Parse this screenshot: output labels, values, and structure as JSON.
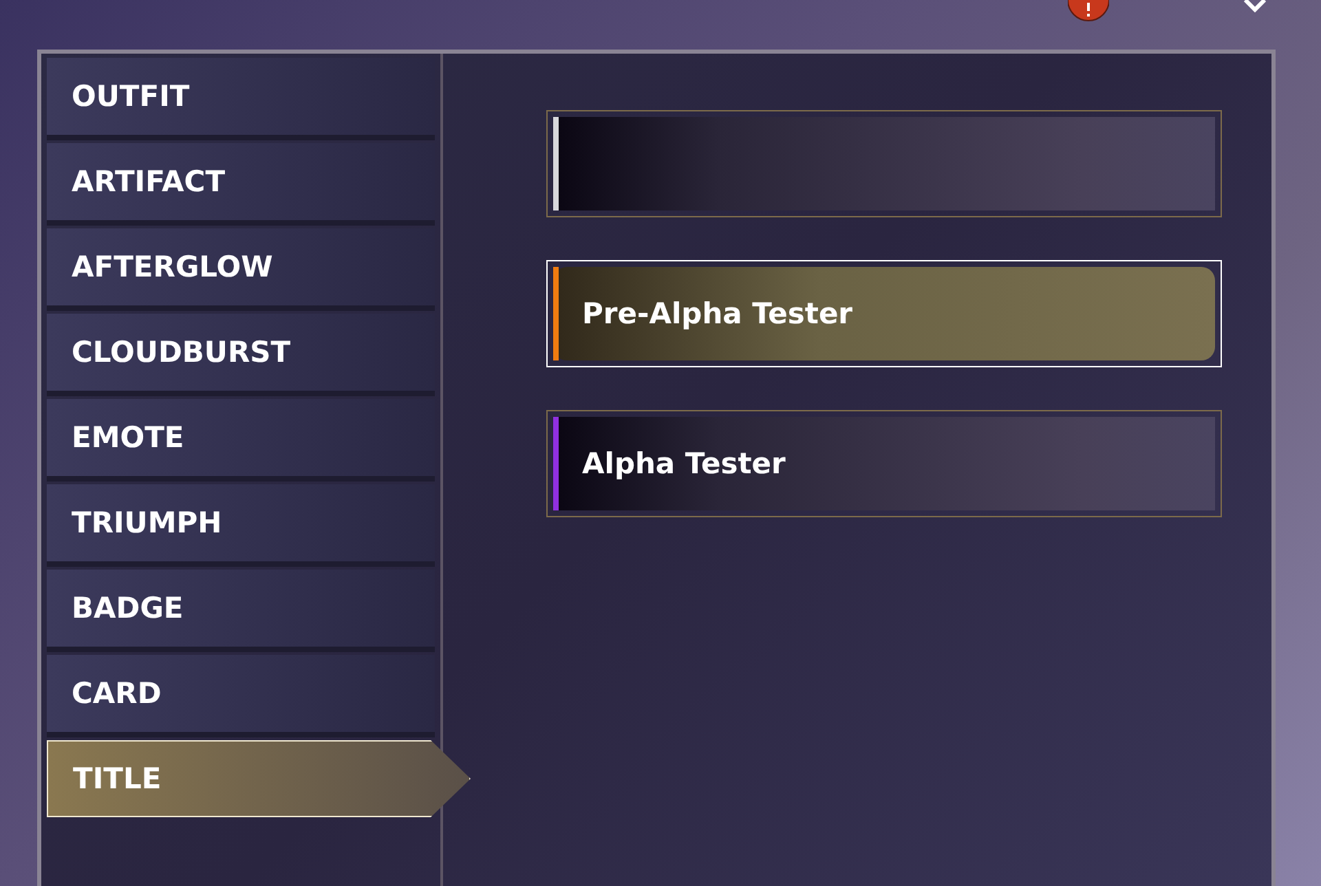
{
  "categories": [
    {
      "label": "OUTFIT",
      "selected": false
    },
    {
      "label": "ARTIFACT",
      "selected": false
    },
    {
      "label": "AFTERGLOW",
      "selected": false
    },
    {
      "label": "CLOUDBURST",
      "selected": false
    },
    {
      "label": "EMOTE",
      "selected": false
    },
    {
      "label": "TRIUMPH",
      "selected": false
    },
    {
      "label": "BADGE",
      "selected": false
    },
    {
      "label": "CARD",
      "selected": false
    },
    {
      "label": "TITLE",
      "selected": true
    }
  ],
  "titles": [
    {
      "color": "#d8d8dc",
      "selected": false
    },
    {
      "name": "Pre-Alpha Tester",
      "color": "#f07c10",
      "selected": true
    },
    {
      "name": "Alpha Tester",
      "color": "#9030e0",
      "selected": false
    }
  ]
}
